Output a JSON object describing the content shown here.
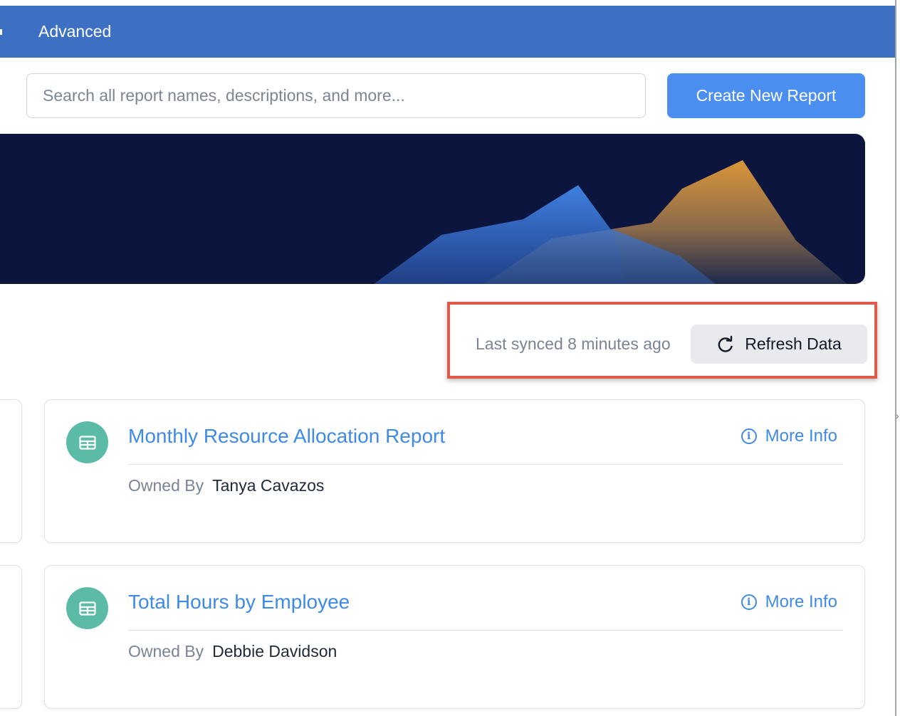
{
  "nav": {
    "active_tab": "Advanced"
  },
  "search": {
    "placeholder": "Search all report names, descriptions, and more..."
  },
  "actions": {
    "create_label": "Create New Report"
  },
  "sync": {
    "status_text": "Last synced 8 minutes ago",
    "refresh_label": "Refresh Data"
  },
  "reports": [
    {
      "title": "Monthly Resource Allocation Report",
      "more_info_label": "More Info",
      "owned_by_label": "Owned By",
      "owner": "Tanya Cavazos"
    },
    {
      "title": "Total Hours by Employee",
      "more_info_label": "More Info",
      "owned_by_label": "Owned By",
      "owner": "Debbie Davidson"
    }
  ],
  "colors": {
    "nav_bg": "#3d6fc3",
    "primary_button": "#4a8ef0",
    "banner_bg": "#0b153d",
    "highlight_border": "#e05a4a",
    "report_icon_bg": "#5bbba6",
    "link": "#3f8ae6"
  },
  "icons": {
    "refresh": "refresh-icon",
    "info": "info-icon",
    "report": "table-icon"
  }
}
